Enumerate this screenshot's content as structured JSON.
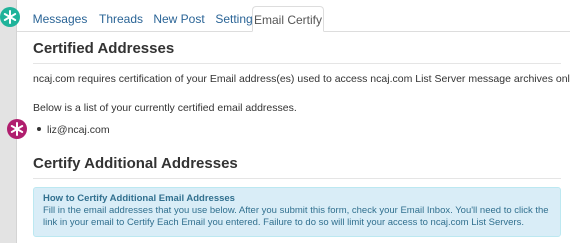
{
  "tabs": [
    {
      "label": "Messages"
    },
    {
      "label": "Threads"
    },
    {
      "label": "New Post"
    },
    {
      "label": "Settings"
    },
    {
      "label": "Email Certify"
    }
  ],
  "active_tab": "Email Certify",
  "certified": {
    "heading": "Certified Addresses",
    "intro": "ncaj.com requires certification of your Email address(es) used to access ncaj.com List Server message archives online.",
    "list_intro": "Below is a list of your currently certified email addresses.",
    "addresses": [
      "liz@ncaj.com"
    ]
  },
  "certify_additional": {
    "heading": "Certify Additional Addresses",
    "info_title": "How to Certify Additional Email Addresses",
    "info_body": "Fill in the email addresses that you use below. After you submit this form, check your Email Inbox. You'll need to click the link in your email to Certify Each Email you entered. Failure to do so will limit your access to ncaj.com List Servers."
  },
  "markers": [
    {
      "icon": "asterisk-icon",
      "color": "#1fb39a"
    },
    {
      "icon": "asterisk-icon",
      "color": "#b01e6e"
    }
  ]
}
